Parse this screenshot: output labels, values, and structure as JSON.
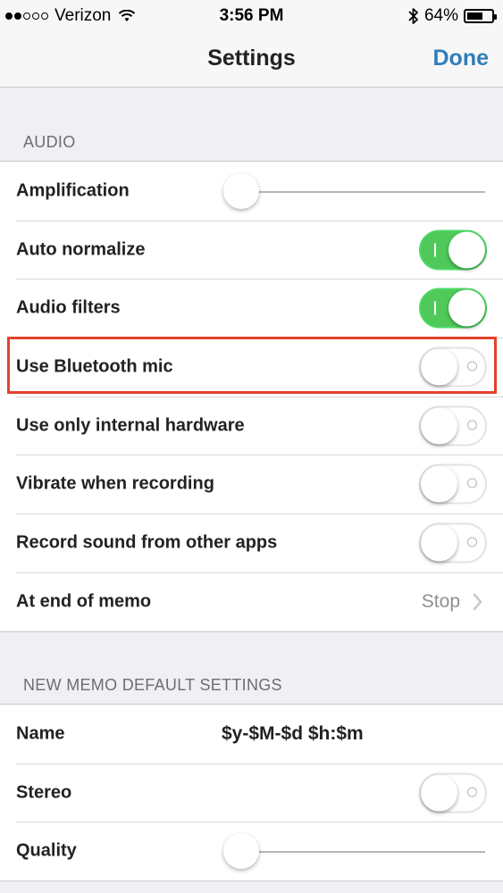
{
  "status_bar": {
    "carrier": "Verizon",
    "signal_bars": 2,
    "signal_total": 5,
    "time": "3:56 PM",
    "battery": "64%",
    "battery_level": 0.64
  },
  "nav": {
    "title": "Settings",
    "done_label": "Done"
  },
  "audio_section": {
    "header": "AUDIO",
    "rows": [
      {
        "label": "Amplification",
        "type": "slider",
        "value": 0
      },
      {
        "label": "Auto normalize",
        "type": "toggle",
        "on": true
      },
      {
        "label": "Audio filters",
        "type": "toggle",
        "on": true
      },
      {
        "label": "Use Bluetooth mic",
        "type": "toggle",
        "on": false,
        "highlighted": true
      },
      {
        "label": "Use only internal hardware",
        "type": "toggle",
        "on": false
      },
      {
        "label": "Vibrate when recording",
        "type": "toggle",
        "on": false
      },
      {
        "label": "Record sound from other apps",
        "type": "toggle",
        "on": false
      },
      {
        "label": "At end of memo",
        "type": "detail",
        "value": "Stop"
      }
    ]
  },
  "defaults_section": {
    "header": "NEW MEMO DEFAULT SETTINGS",
    "rows": [
      {
        "label": "Name",
        "type": "value",
        "value": "$y-$M-$d $h:$m"
      },
      {
        "label": "Stereo",
        "type": "toggle",
        "on": false
      },
      {
        "label": "Quality",
        "type": "slider",
        "value": 0
      }
    ]
  },
  "colors": {
    "accent": "#2f7eb8",
    "toggle_on": "#4ec95a",
    "highlight": "#e2422d"
  }
}
